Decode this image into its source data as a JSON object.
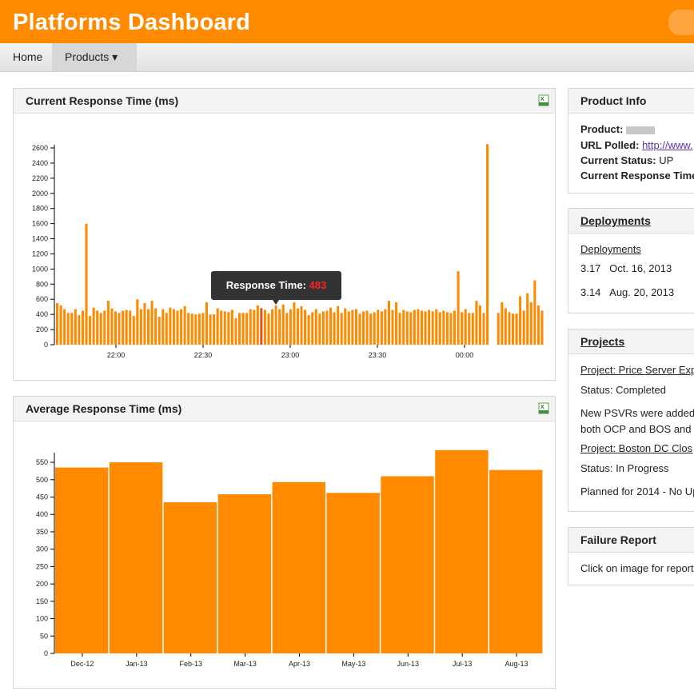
{
  "app": {
    "title": "Platforms Dashboard"
  },
  "nav": {
    "home": "Home",
    "products": "Products ▾"
  },
  "panels": {
    "current": {
      "title": "Current Response Time (ms)"
    },
    "average": {
      "title": "Average Response Time (ms)"
    }
  },
  "tooltip": {
    "label": "Response Time:",
    "value": "483"
  },
  "product_info": {
    "title": "Product Info",
    "product_label": "Product:",
    "url_label": "URL Polled:",
    "url_value": "http://www.",
    "status_label": "Current Status:",
    "status_value": "UP",
    "response_label": "Current Response Time"
  },
  "deployments": {
    "title": "Deployments",
    "subtitle": "Deployments",
    "items": [
      {
        "version": "3.17",
        "date": "Oct. 16, 2013"
      },
      {
        "version": "3.14",
        "date": "Aug. 20, 2013"
      }
    ]
  },
  "projects": {
    "title": "Projects",
    "p1_link": "Project: Price Server Exp",
    "p1_status": "Status: Completed",
    "p1_desc1": "New PSVRs were added",
    "p1_desc2": "both OCP and BOS and",
    "p2_link": "Project: Boston DC Clos",
    "p2_status": "Status: In Progress",
    "p2_desc": "Planned for 2014 - No Up"
  },
  "failure": {
    "title": "Failure Report",
    "body": "Click on image for report"
  },
  "colors": {
    "accent": "#ff8a00",
    "highlight_bar": "#e8501a",
    "tooltip_value": "#ff2222"
  },
  "chart_data": [
    {
      "type": "bar",
      "title": "Current Response Time (ms)",
      "ylim": [
        0,
        2600
      ],
      "yticks": [
        0,
        200,
        400,
        600,
        800,
        1000,
        1200,
        1400,
        1600,
        1800,
        2000,
        2200,
        2400,
        2600
      ],
      "xticks": [
        "22:00",
        "22:30",
        "23:00",
        "23:30",
        "00:00"
      ],
      "highlight_index": 56,
      "values": [
        550,
        520,
        470,
        420,
        420,
        470,
        390,
        450,
        1600,
        380,
        490,
        450,
        420,
        450,
        580,
        480,
        440,
        420,
        450,
        460,
        450,
        380,
        600,
        470,
        550,
        470,
        580,
        480,
        370,
        470,
        420,
        490,
        470,
        450,
        470,
        510,
        420,
        410,
        400,
        410,
        420,
        560,
        400,
        400,
        480,
        450,
        440,
        430,
        460,
        350,
        420,
        420,
        420,
        470,
        460,
        520,
        483,
        460,
        410,
        470,
        520,
        470,
        530,
        420,
        470,
        560,
        480,
        510,
        460,
        390,
        430,
        470,
        410,
        440,
        450,
        490,
        430,
        510,
        420,
        480,
        440,
        460,
        470,
        410,
        440,
        450,
        410,
        430,
        460,
        440,
        470,
        580,
        460,
        560,
        420,
        460,
        440,
        430,
        460,
        470,
        450,
        440,
        460,
        440,
        470,
        430,
        450,
        430,
        420,
        450,
        970,
        430,
        470,
        420,
        420,
        580,
        520,
        420,
        2650,
        null,
        null,
        420,
        560,
        480,
        430,
        410,
        410,
        640,
        450,
        680,
        560,
        850,
        520,
        450
      ]
    },
    {
      "type": "bar",
      "title": "Average Response Time (ms)",
      "ylim": [
        0,
        550
      ],
      "yticks": [
        0,
        50,
        100,
        150,
        200,
        250,
        300,
        350,
        400,
        450,
        500,
        550
      ],
      "categories": [
        "Dec-12",
        "Jan-13",
        "Feb-13",
        "Mar-13",
        "Apr-13",
        "May-13",
        "Jun-13",
        "Jul-13",
        "Aug-13"
      ],
      "values": [
        535,
        550,
        435,
        458,
        493,
        462,
        510,
        585,
        528
      ]
    }
  ]
}
